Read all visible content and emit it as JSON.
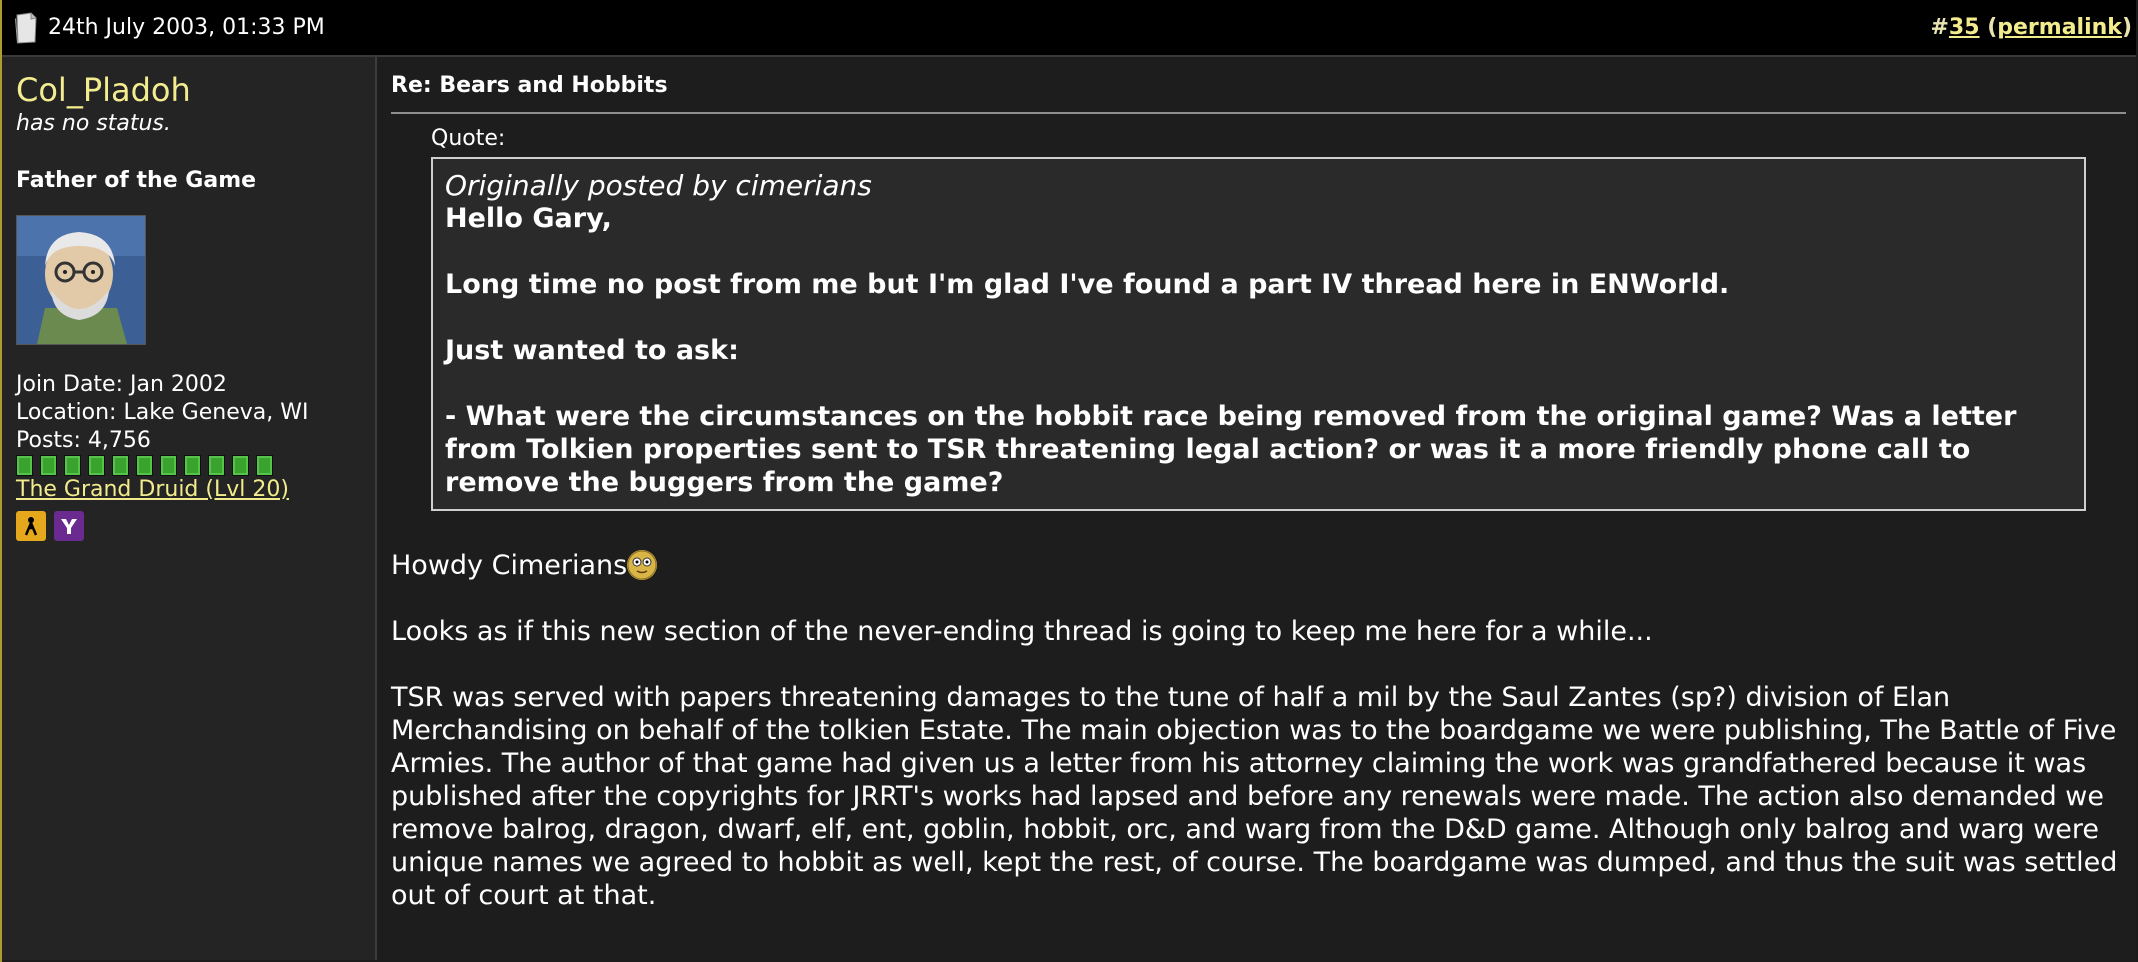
{
  "header": {
    "date": "24th July 2003, 01:33 PM",
    "post_number_prefix": "#",
    "post_number": "35",
    "permalink_open": " (",
    "permalink_label": "permalink",
    "permalink_close": ")"
  },
  "user": {
    "name": "Col_Pladoh",
    "status": "has no status.",
    "title": "Father of the Game",
    "join_date": "Join Date: Jan 2002",
    "location": "Location: Lake Geneva, WI",
    "posts": "Posts: 4,756",
    "reputation_pips": 11,
    "rank_link": "The Grand Druid (Lvl 20)",
    "im_icons": [
      "aim-icon",
      "yahoo-icon"
    ]
  },
  "post": {
    "title": "Re: Bears and Hobbits",
    "quote_label": "Quote:",
    "quote_author": "Originally posted by cimerians",
    "quote_paragraphs": [
      "Hello Gary,",
      "Long time no post from me but I'm glad I've found a part IV thread here in ENWorld.",
      "Just wanted to ask:",
      "- What were the circumstances on the hobbit race being removed from the original game? Was a letter from Tolkien properties sent to TSR threatening legal action? or was it a more friendly phone call to remove the buggers from the game?"
    ],
    "greeting": "Howdy Cimerians",
    "paragraph_1": "Looks as if this new section of the never-ending thread is going to keep me here for a while...",
    "paragraph_2": "TSR was served with papers threatening damages to the tune of half a mil by the Saul Zantes (sp?) division of Elan Merchandising on behalf of the tolkien Estate. The main objection was to the boardgame we were publishing, The Battle of Five Armies. The author of that game had given us a letter from his attorney claiming the work was grandfathered because it was published after the copyrights for JRRT's works had lapsed and before any renewals were made. The action also demanded we remove balrog, dragon, dwarf, elf, ent, goblin, hobbit, orc, and warg from the D&D game. Although only balrog and warg were unique names we agreed to hobbit as well, kept the rest, of course. The boardgame was dumped, and thus the suit was settled out of court at that."
  },
  "colors": {
    "accent": "#f2ec8d",
    "background": "#1d1d1d",
    "header": "#000000"
  }
}
